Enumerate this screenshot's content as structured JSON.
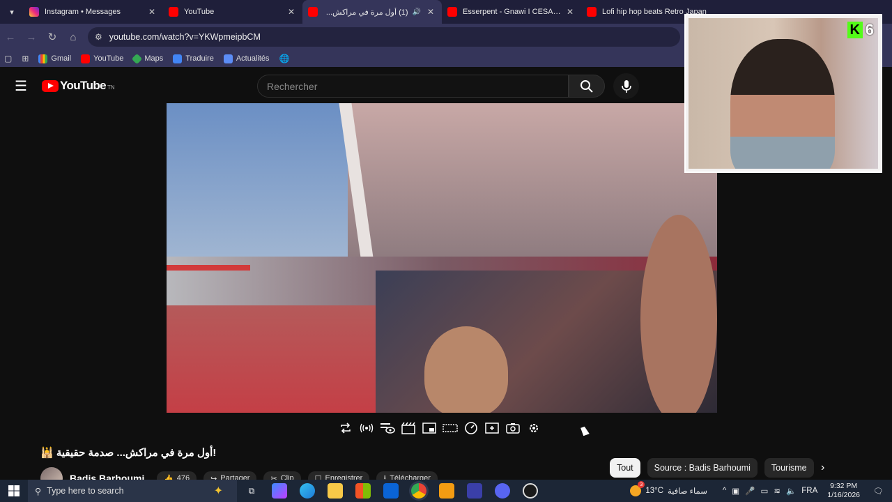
{
  "browser": {
    "tabs": [
      {
        "title": "Instagram • Messages",
        "active": false,
        "favicon": "instagram-icon"
      },
      {
        "title": "YouTube",
        "active": false,
        "favicon": "youtube-icon"
      },
      {
        "title": "أول مرة في مراكش...",
        "badge": "(1)",
        "active": true,
        "favicon": "youtube-icon",
        "muted_icon": "speaker-icon"
      },
      {
        "title": "Esserpent - Gnawi I CESAR ART",
        "active": false,
        "favicon": "youtube-icon"
      },
      {
        "title": "Lofi hip hop beats Retro Japan",
        "active": false,
        "favicon": "youtube-icon"
      }
    ],
    "url": "youtube.com/watch?v=YKWpmeipbCM",
    "bookmarks": [
      {
        "label": "Gmail",
        "icon": "gmail-icon"
      },
      {
        "label": "YouTube",
        "icon": "youtube-icon"
      },
      {
        "label": "Maps",
        "icon": "maps-icon"
      },
      {
        "label": "Traduire",
        "icon": "translate-icon"
      },
      {
        "label": "Actualités",
        "icon": "news-icon"
      }
    ]
  },
  "youtube": {
    "logo_text": "YouTube",
    "country_code": "TN",
    "search_placeholder": "Rechercher",
    "video_title": "!أول مرة في مراكش... صدمة حقيقية 🕌",
    "channel_name": "Badis Barhoumi",
    "actions": {
      "like": "476",
      "share": "Partager",
      "clip": "Clip",
      "save": "Enregistrer",
      "download": "Télécharger"
    },
    "chips": [
      {
        "label": "Tout",
        "selected": true
      },
      {
        "label": "Source : Badis Barhoumi",
        "selected": false
      },
      {
        "label": "Tourisme",
        "selected": false
      }
    ]
  },
  "overlay": {
    "kick_logo": "K",
    "viewer_count": "6"
  },
  "taskbar": {
    "search_placeholder": "Type here to search",
    "weather_temp": "13°C",
    "weather_text": "سماء صافية",
    "weather_badge": "3",
    "language": "FRA",
    "time": "9:32 PM",
    "date": "1/16/2026"
  },
  "colors": {
    "yt_red": "#ff0000",
    "kick_green": "#53fc18",
    "browser_chrome": "#35355a"
  }
}
